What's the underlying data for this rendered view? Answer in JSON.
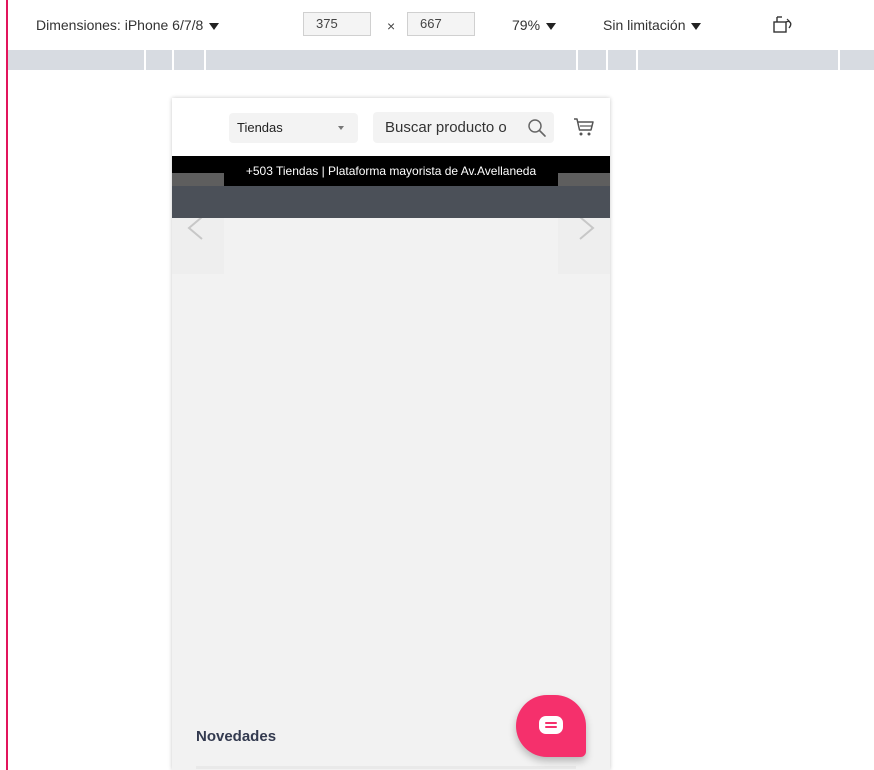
{
  "devtools": {
    "dimensions_label": "Dimensiones: iPhone 6/7/8",
    "width_value": "375",
    "times_sign": "×",
    "height_value": "667",
    "zoom_label": "79%",
    "throttle_label": "Sin limitación",
    "accent_color": "#e2145c",
    "rotate_icon": "rotate-device-icon"
  },
  "header": {
    "store_select_value": "Tiendas",
    "search_placeholder": "Buscar producto o",
    "search_icon": "search-icon",
    "cart_icon": "cart-icon"
  },
  "announcement": {
    "text": "+503 Tiendas | Plataforma mayorista de Av.Avellaneda"
  },
  "slider": {
    "prev_icon": "chevron-left-icon",
    "next_icon": "chevron-right-icon"
  },
  "sections": {
    "novedades_title": "Novedades"
  },
  "chat": {
    "icon": "chat-bubble-icon",
    "color": "#f5306c"
  }
}
